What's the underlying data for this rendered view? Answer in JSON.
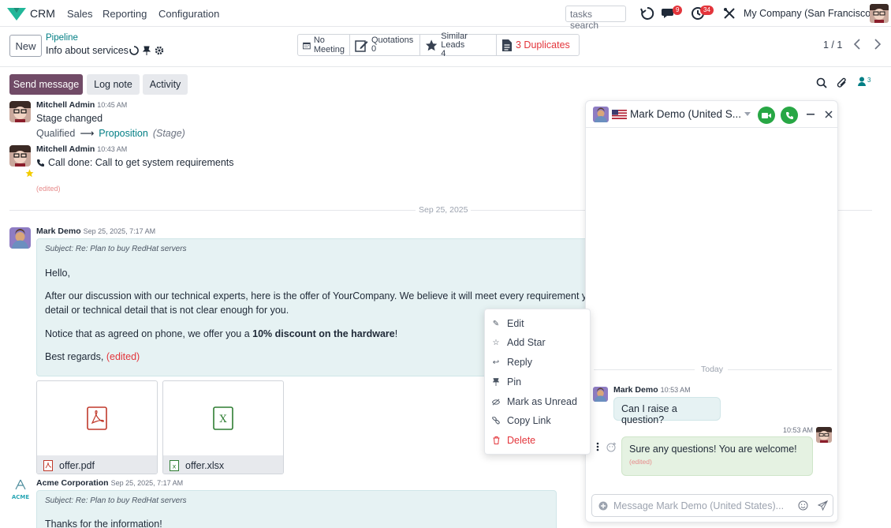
{
  "navbar": {
    "app_name": "CRM",
    "menu": [
      "Sales",
      "Reporting",
      "Configuration"
    ],
    "search_placeholder": "tasks search",
    "messages_badge": "9",
    "activities_badge": "34",
    "company": "My Company (San Francisco)"
  },
  "control": {
    "new_label": "New",
    "breadcrumb": "Pipeline",
    "record_title": "Info about services",
    "smart": {
      "meeting": "No Meeting",
      "quotations_label": "Quotations",
      "quotations_count": "0",
      "similar_label": "Similar Leads",
      "similar_count": "4",
      "duplicates": "3 Duplicates"
    },
    "pager": "1 / 1"
  },
  "chatter": {
    "send_message": "Send message",
    "log_note": "Log note",
    "activity": "Activity",
    "followers_count": "3",
    "messages": [
      {
        "author": "Mitchell Admin",
        "time": "10:45 AM",
        "line1": "Stage changed",
        "old_stage": "Qualified",
        "new_stage": "Proposition",
        "field": "(Stage)"
      },
      {
        "author": "Mitchell Admin",
        "time": "10:43 AM",
        "line1": "Call done: Call to get system requirements",
        "edited": "(edited)"
      }
    ],
    "date_separator": "Sep 25, 2025",
    "email": {
      "author": "Mark Demo",
      "time": "Sep 25, 2025, 7:17 AM",
      "subject": "Subject: Re: Plan to buy RedHat servers",
      "greeting": "Hello,",
      "para1a": "After our discussion with our technical experts, here is the offer of YourCompany. We believe it will meet every requirement you h",
      "para1b": "detail or technical detail that is not clear enough for you.",
      "para2_pre": "Notice that as agreed on phone, we offer you a ",
      "para2_bold": "10% discount on the hardware",
      "para2_post": "!",
      "regards": "Best regards,",
      "edited": "(edited)",
      "attachments": [
        "offer.pdf",
        "offer.xlsx"
      ]
    },
    "email2": {
      "author": "Acme Corporation",
      "time": "Sep 25, 2025, 7:17 AM",
      "subject": "Subject: Re: Plan to buy RedHat servers",
      "body": "Thanks for the information!",
      "logo_text": "ACME"
    }
  },
  "context_menu": {
    "items": [
      "Edit",
      "Add Star",
      "Reply",
      "Pin",
      "Mark as Unread",
      "Copy Link",
      "Delete"
    ]
  },
  "chat_window": {
    "title": "Mark Demo (United S...",
    "day": "Today",
    "incoming": {
      "author": "Mark Demo",
      "time": "10:53 AM",
      "text": "Can I raise a question?"
    },
    "outgoing": {
      "time": "10:53 AM",
      "text": "Sure any questions! You are welcome!",
      "edited": "(edited)"
    },
    "composer_placeholder": "Message Mark Demo (United States)..."
  },
  "colors": {
    "primary": "#714b67",
    "link": "#017e84",
    "danger": "#e3353b",
    "call_green": "#28a745"
  }
}
